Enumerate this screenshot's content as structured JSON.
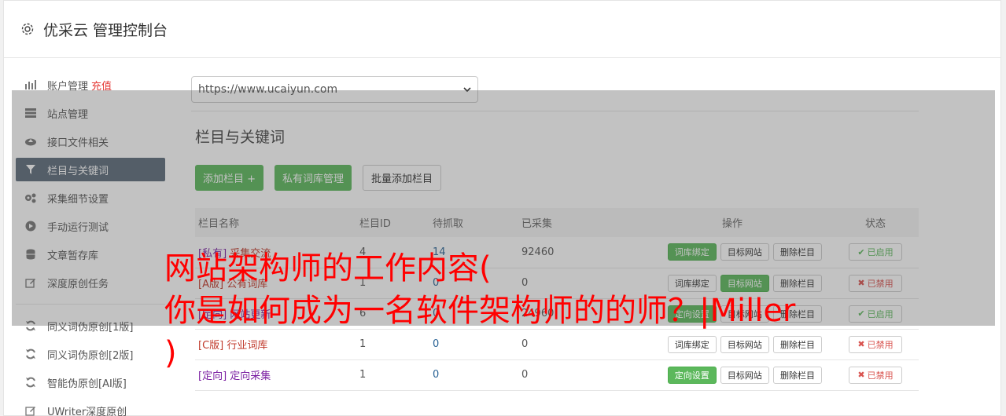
{
  "header": {
    "title": "优采云 管理控制台",
    "icon": "gear-icon"
  },
  "sidebar": {
    "items": [
      {
        "label": "账户管理",
        "extra": "充值",
        "icon": "bar-chart-icon"
      },
      {
        "label": "站点管理",
        "icon": "server-icon"
      },
      {
        "label": "接口文件相关",
        "icon": "cloud-upload-icon"
      },
      {
        "label": "栏目与关键词",
        "icon": "filter-icon",
        "active": true
      },
      {
        "label": "采集细节设置",
        "icon": "cogs-icon"
      },
      {
        "label": "手动运行测试",
        "icon": "play-circle-icon"
      },
      {
        "label": "文章暂存库",
        "icon": "database-icon"
      },
      {
        "label": "深度原创任务",
        "icon": "edit-icon"
      }
    ],
    "items2": [
      {
        "label": "同义词伪原创[1版]",
        "icon": "refresh-icon"
      },
      {
        "label": "同义词伪原创[2版]",
        "icon": "refresh-icon"
      },
      {
        "label": "智能伪原创[AI版]",
        "icon": "refresh-icon"
      },
      {
        "label": "UWriter深度原创",
        "icon": "edit-icon"
      }
    ]
  },
  "main": {
    "site_select": {
      "value": "https://www.ucaiyun.com"
    },
    "section_title": "栏目与关键词",
    "buttons": {
      "add_column": "添加栏目 +",
      "private_lib": "私有词库管理",
      "batch_add": "批量添加栏目"
    },
    "table": {
      "headers": [
        "栏目名称",
        "栏目ID",
        "待抓取",
        "已采集",
        "操作",
        "状态"
      ],
      "rows": [
        {
          "prefix": "[私有]",
          "name": "采集交流",
          "id": "4",
          "pending": "14",
          "collected": "92460",
          "action1": "词库绑定",
          "action1_green": true,
          "action2": "目标网站",
          "action2_green": false,
          "action3": "删除栏目",
          "status": "已启用",
          "enabled": true
        },
        {
          "prefix": "[A版]",
          "name": "公有词库",
          "id": "1",
          "pending": "0",
          "collected": "0",
          "action1": "词库绑定",
          "action1_green": false,
          "action2": "目标网站",
          "action2_green": true,
          "action3": "删除栏目",
          "status": "已禁用",
          "enabled": false
        },
        {
          "prefix": "[定向]",
          "name": "网站更新",
          "id": "6",
          "pending": "0",
          "collected": "24960",
          "action1": "定向设置",
          "action1_green": true,
          "action2": "目标网站",
          "action2_green": false,
          "action3": "删除栏目",
          "status": "已启用",
          "enabled": true
        },
        {
          "prefix": "[C版]",
          "name": "行业词库",
          "id": "1",
          "pending": "0",
          "collected": "0",
          "action1": "词库绑定",
          "action1_green": false,
          "action2": "目标网站",
          "action2_green": false,
          "action3": "删除栏目",
          "status": "已禁用",
          "enabled": false
        },
        {
          "prefix": "[定向]",
          "name": "定向采集",
          "id": "1",
          "pending": "0",
          "collected": "0",
          "action1": "定向设置",
          "action1_green": true,
          "action2": "目标网站",
          "action2_green": false,
          "action3": "删除栏目",
          "status": "已禁用",
          "enabled": false
        }
      ]
    }
  },
  "overlay_caption": {
    "line1": "网站架构师的工作内容(",
    "line2": "你是如何成为一名软件架构师的的师？|Miller",
    "line3": ")"
  },
  "colors": {
    "active_nav": "#5c6b7a",
    "green": "#5cb85c",
    "red_text": "#ff0000"
  }
}
